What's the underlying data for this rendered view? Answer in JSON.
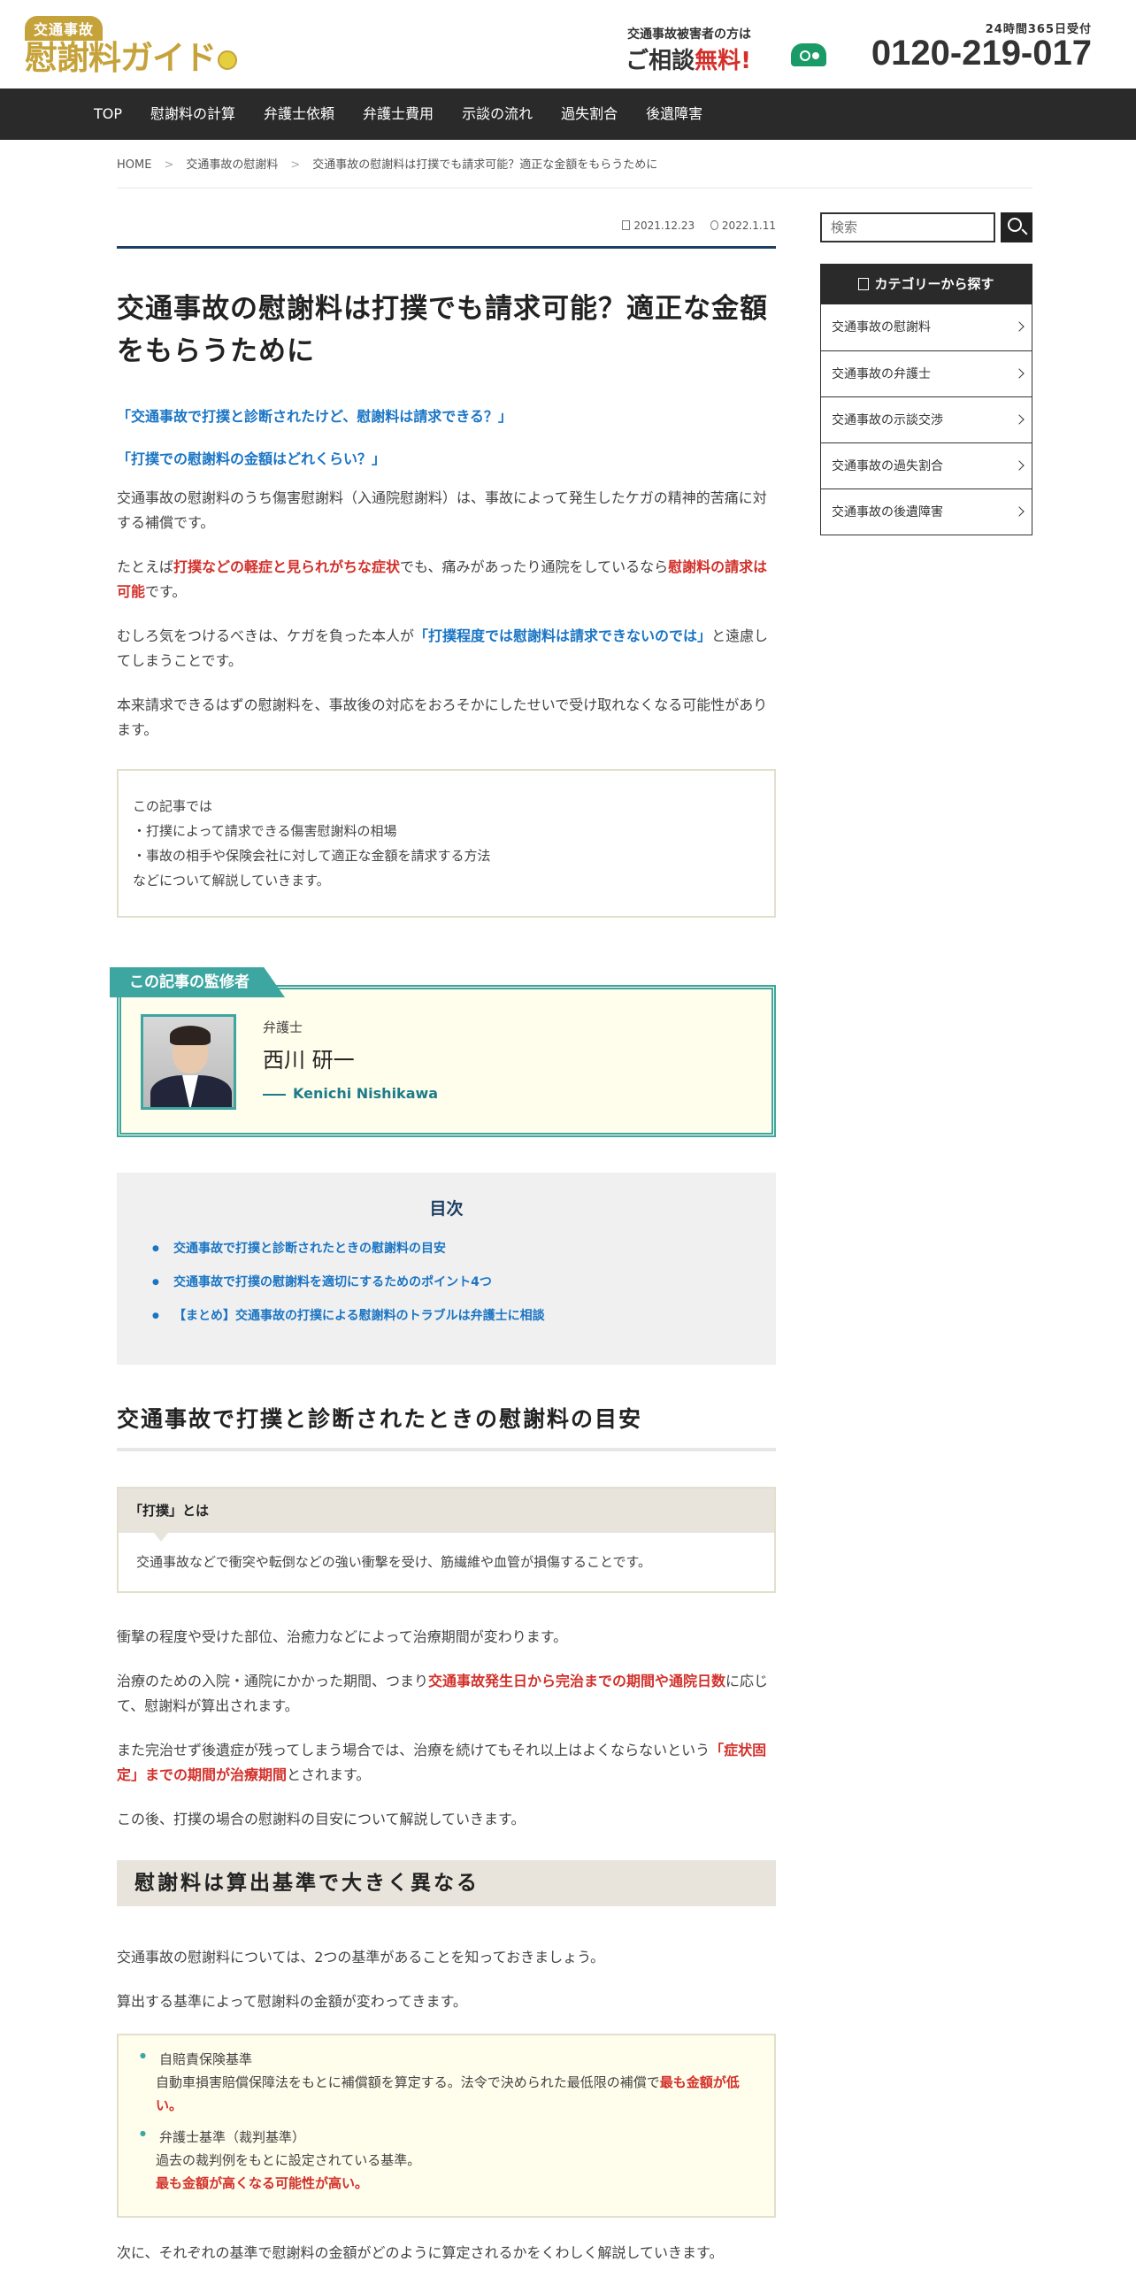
{
  "header": {
    "logo_top": "交通事故",
    "logo_main": "慰謝料ガイド",
    "hours": "24時間365日受付",
    "victim_text": "交通事故被害者の方は",
    "consult_text": "ご相談",
    "free_text": "無料!",
    "phone": "0120-219-017"
  },
  "nav": {
    "items": [
      "TOP",
      "慰謝料の計算",
      "弁護士依頼",
      "弁護士費用",
      "示談の流れ",
      "過失割合",
      "後遺障害"
    ]
  },
  "breadcrumb": {
    "items": [
      "HOME",
      "交通事故の慰謝料",
      "交通事故の慰謝料は打撲でも請求可能？適正な金額をもらうために"
    ],
    "separator": ">"
  },
  "article": {
    "published": "2021.12.23",
    "updated": "2022.1.11",
    "title": "交通事故の慰謝料は打撲でも請求可能？適正な金額をもらうために",
    "q1": "「交通事故で打撲と診断されたけど、慰謝料は請求できる？」",
    "q2": "「打撲での慰謝料の金額はどれくらい？」",
    "p1": "交通事故の慰謝料のうち傷害慰謝料（入通院慰謝料）は、事故によって発生したケガの精神的苦痛に対する補償です。",
    "p2_a": "たとえば",
    "p2_b": "打撲などの軽症と見られがちな症状",
    "p2_c": "でも、痛みがあったり通院をしているなら",
    "p2_d": "慰謝料の請求は可能",
    "p2_e": "です。",
    "p3_a": "むしろ気をつけるべきは、ケガを負った本人が",
    "p3_b": "「打撲程度では慰謝料は請求できないのでは」",
    "p3_c": "と遠慮してしまうことです。",
    "p4": "本来請求できるはずの慰謝料を、事故後の対応をおろそかにしたせいで受け取れなくなる可能性があります。",
    "summary": [
      "この記事では",
      "・打撲によって請求できる傷害慰謝料の相場",
      "・事故の相手や保険会社に対して適正な金額を請求する方法",
      "などについて解説していきます。"
    ]
  },
  "supervisor": {
    "tag": "この記事の監修者",
    "role": "弁護士",
    "name": "西川 研一",
    "name_en": "Kenichi Nishikawa"
  },
  "toc": {
    "title": "目次",
    "items": [
      "交通事故で打撲と診断されたときの慰謝料の目安",
      "交通事故で打撲の慰謝料を適切にするためのポイント4つ",
      "【まとめ】交通事故の打撲による慰謝料のトラブルは弁護士に相談"
    ]
  },
  "section1": {
    "heading": "交通事故で打撲と診断されたときの慰謝料の目安",
    "def_title": "「打撲」とは",
    "def_body": "交通事故などで衝突や転倒などの強い衝撃を受け、筋繊維や血管が損傷することです。",
    "p1": "衝撃の程度や受けた部位、治癒力などによって治療期間が変わります。",
    "p2_a": "治療のための入院・通院にかかった期間、つまり",
    "p2_b": "交通事故発生日から完治までの期間や通院日数",
    "p2_c": "に応じて、慰謝料が算出されます。",
    "p3_a": "また完治せず後遺症が残ってしまう場合では、治療を続けてもそれ以上はよくならないという",
    "p3_b": "「症状固定」までの期間が治療期間",
    "p3_c": "とされます。",
    "p4": "この後、打撲の場合の慰謝料の目安について解説していきます。"
  },
  "section2": {
    "heading": "慰謝料は算出基準で大きく異なる",
    "p1": "交通事故の慰謝料については、2つの基準があることを知っておきましょう。",
    "p2": "算出する基準によって慰謝料の金額が変わってきます。",
    "std1_name": "自賠責保険基準",
    "std1_desc_a": "自動車損害賠償保障法をもとに補償額を算定する。法令で決められた最低限の補償で",
    "std1_desc_b": "最も金額が低い。",
    "std2_name": "弁護士基準（裁判基準）",
    "std2_desc_a": "過去の裁判例をもとに設定されている基準。",
    "std2_desc_b": "最も金額が高くなる可能性が高い。",
    "p3": "次に、それぞれの基準で慰謝料の金額がどのように算定されるかをくわしく解説していきます。"
  },
  "sidebar": {
    "search_placeholder": "検索",
    "category_title": "カテゴリーから探す",
    "categories": [
      "交通事故の慰謝料",
      "交通事故の弁護士",
      "交通事故の示談交渉",
      "交通事故の過失割合",
      "交通事故の後遺障害"
    ]
  },
  "colors": {
    "nav_bg": "#2a2a2a",
    "accent_red": "#d3302a",
    "accent_blue": "#1a75c4",
    "teal": "#3ea6a0",
    "logo_gold": "#c6a23a"
  }
}
